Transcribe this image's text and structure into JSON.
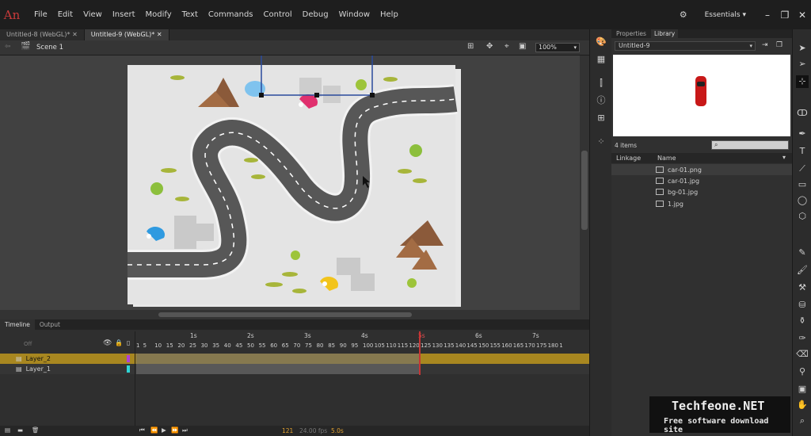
{
  "app": {
    "logo": "An"
  },
  "menu": [
    "File",
    "Edit",
    "View",
    "Insert",
    "Modify",
    "Text",
    "Commands",
    "Control",
    "Debug",
    "Window",
    "Help"
  ],
  "workspace": {
    "label": "Essentials ▾"
  },
  "window_controls": {
    "minimize": "–",
    "restore": "❐",
    "close": "✕"
  },
  "doc_tabs": [
    {
      "label": "Untitled-8 (WebGL)*",
      "close": "✕"
    },
    {
      "label": "Untitled-9 (WebGL)*",
      "close": "✕"
    }
  ],
  "editbar": {
    "scene": "Scene 1",
    "zoom": "100%"
  },
  "timeline": {
    "tabs": [
      "Timeline",
      "Output"
    ],
    "off_label": "Off",
    "time_marks": [
      "1s",
      "2s",
      "3s",
      "4s",
      "5s",
      "6s",
      "7s"
    ],
    "frame_numbers": [
      "1",
      "5",
      "10",
      "15",
      "20",
      "25",
      "30",
      "35",
      "40",
      "45",
      "50",
      "55",
      "60",
      "65",
      "70",
      "75",
      "80",
      "85",
      "90",
      "95",
      "100",
      "105",
      "110",
      "115",
      "120",
      "125",
      "130",
      "135",
      "140",
      "145",
      "150",
      "155",
      "160",
      "165",
      "170",
      "175",
      "180",
      "1"
    ],
    "layers": [
      {
        "name": "Layer_2",
        "color": "#b042d6"
      },
      {
        "name": "Layer_1",
        "color": "#2fd6d6"
      }
    ],
    "status": {
      "frame": "121",
      "fps": "24.00 fps",
      "time": "5.0s"
    }
  },
  "library": {
    "tabs": [
      "Properties",
      "Library"
    ],
    "document": "Untitled-9",
    "count": "4 items",
    "columns": {
      "linkage": "Linkage",
      "name": "Name"
    },
    "items": [
      "car-01.png",
      "car-01.jpg",
      "bg-01.jpg",
      "1.jpg"
    ]
  },
  "watermark": {
    "title": "Techfeone.NET",
    "subtitle": "Free software download site"
  },
  "colors": {
    "accent": "#c83a3a",
    "layer_selected": "#a88720",
    "playhead": "#c63535"
  }
}
